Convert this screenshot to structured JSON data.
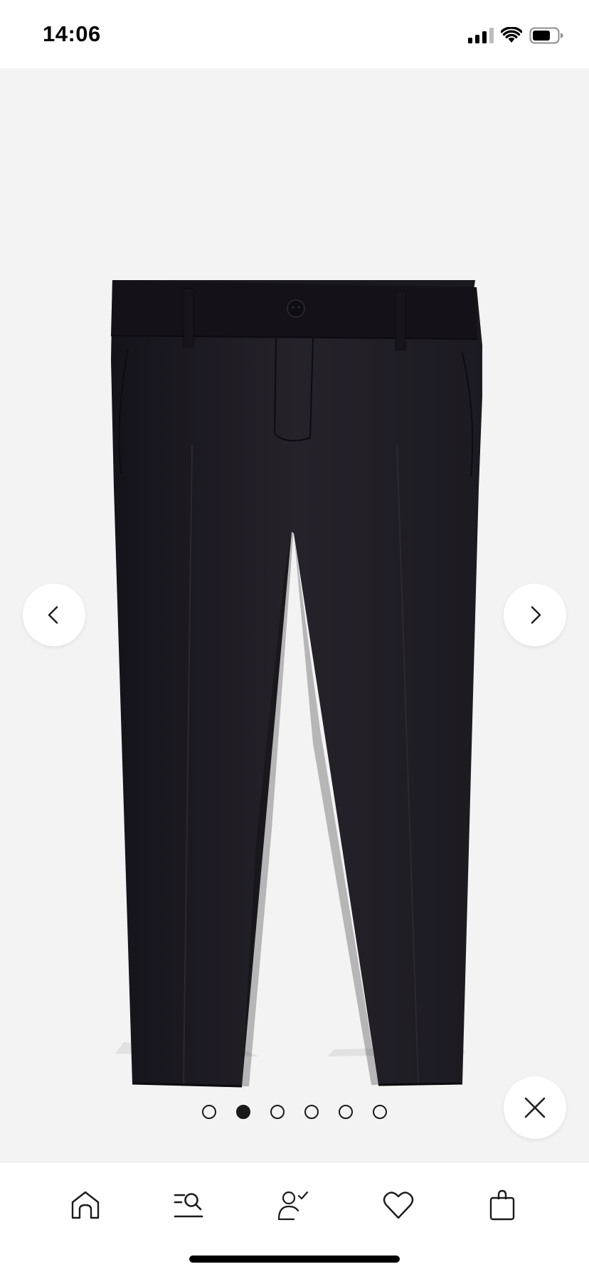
{
  "status_bar": {
    "time": "14:06",
    "icons": [
      "signal-icon",
      "wifi-icon",
      "battery-icon"
    ]
  },
  "gallery": {
    "product_image": "black-tailored-trousers",
    "image_count": 6,
    "active_index": 1,
    "controls": {
      "prev_icon": "chevron-left-icon",
      "next_icon": "chevron-right-icon",
      "close_icon": "close-icon"
    },
    "colors": {
      "background": "#f3f3f3",
      "garment": "#1f1c23"
    }
  },
  "tab_bar": {
    "items": [
      {
        "icon": "home-icon"
      },
      {
        "icon": "search-list-icon"
      },
      {
        "icon": "account-check-icon"
      },
      {
        "icon": "heart-icon"
      },
      {
        "icon": "shopping-bag-icon"
      }
    ]
  }
}
